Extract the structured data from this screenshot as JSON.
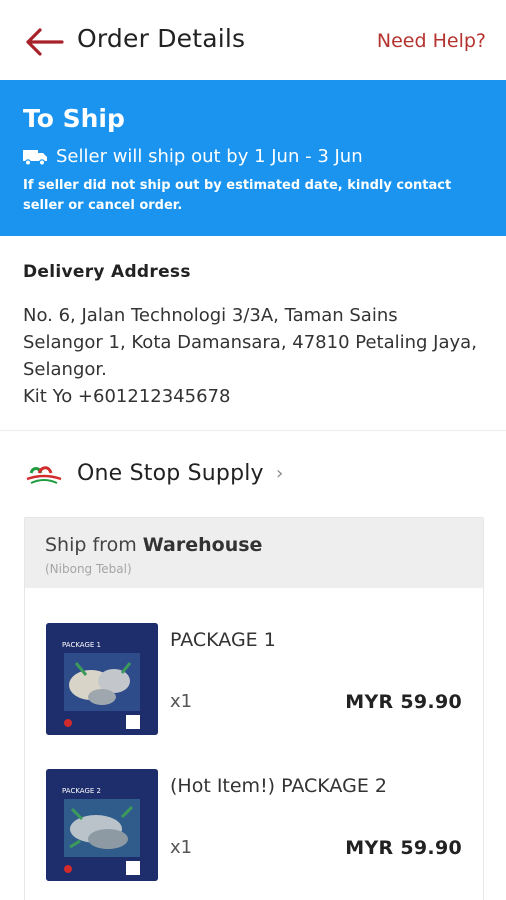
{
  "header": {
    "title": "Order Details",
    "help_label": "Need Help?"
  },
  "status": {
    "title": "To Ship",
    "ship_line": "Seller will ship out by 1 Jun - 3 Jun",
    "note": "If seller did not ship out by estimated date, kindly contact seller or cancel order.",
    "icon": "truck-icon",
    "color": "#1a94ef"
  },
  "address": {
    "label": "Delivery Address",
    "line": "No. 6, Jalan Technologi 3/3A, Taman Sains Selangor 1, Kota Damansara, 47810 Petaling Jaya, Selangor.",
    "contact": "Kit Yo +601212345678"
  },
  "shop": {
    "name": "One Stop Supply",
    "chevron": "›"
  },
  "package": {
    "ship_from_prefix": "Ship from",
    "ship_from_place": "Warehouse",
    "ship_from_sub": "(Nibong Tebal)",
    "items": [
      {
        "name": "PACKAGE 1",
        "qty": "x1",
        "price": "MYR 59.90",
        "thumb_label": "PACKAGE 1"
      },
      {
        "name": "(Hot Item!) PACKAGE 2",
        "qty": "x1",
        "price": "MYR 59.90",
        "thumb_label": "PACKAGE 2"
      }
    ]
  },
  "colors": {
    "accent": "#b5332f",
    "banner": "#1a94ef"
  }
}
